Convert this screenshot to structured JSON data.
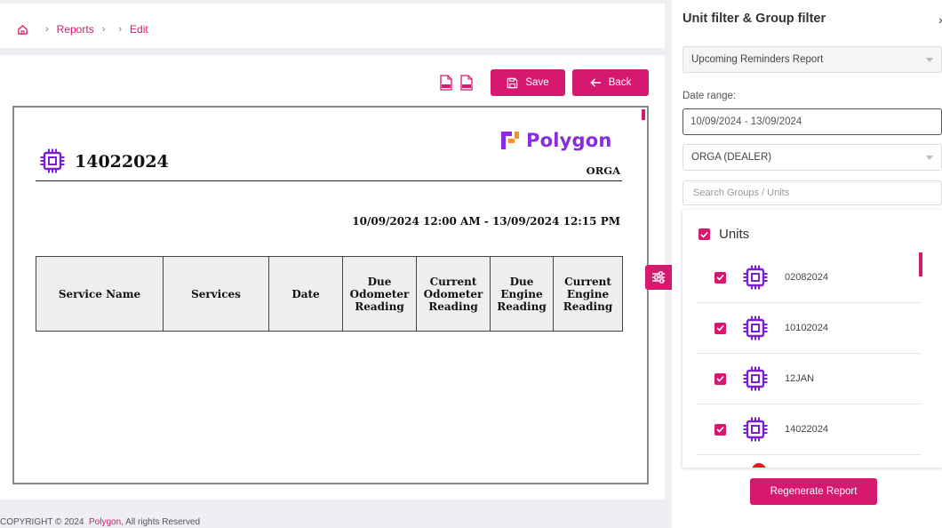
{
  "breadcrumb": {
    "reports": "Reports",
    "edit": "Edit"
  },
  "toolbar": {
    "save_label": "Save",
    "back_label": "Back",
    "xls_icon": "xls-file-icon",
    "pdf_icon": "pdf-file-icon"
  },
  "report": {
    "unit_name": "14022024",
    "brand": "Polygon",
    "company": "ORGA",
    "date_range": "10/09/2024 12:00 AM - 13/09/2024 12:15 PM",
    "columns": [
      "Service Name",
      "Services",
      "Date",
      "Due Odometer Reading",
      "Current Odometer Reading",
      "Due Engine Reading",
      "Current Engine Reading"
    ]
  },
  "footer": {
    "prefix": "COPYRIGHT © 2024",
    "brand": "Polygon",
    "suffix": ", All rights Reserved"
  },
  "panel": {
    "title": "Unit filter & Group filter",
    "report_type": "Upcoming Reminders Report",
    "date_label": "Date range:",
    "date_value": "10/09/2024 - 13/09/2024",
    "company": "ORGA (DEALER)",
    "search_placeholder": "Search Groups / Units",
    "units_label": "Units",
    "units": [
      "02082024",
      "10102024",
      "12JAN",
      "14022024"
    ],
    "regenerate_label": "Regenerate Report"
  },
  "colors": {
    "accent": "#d6186e",
    "brand_purple": "#8a2be2",
    "unit_icon": "#7b1fd6"
  }
}
